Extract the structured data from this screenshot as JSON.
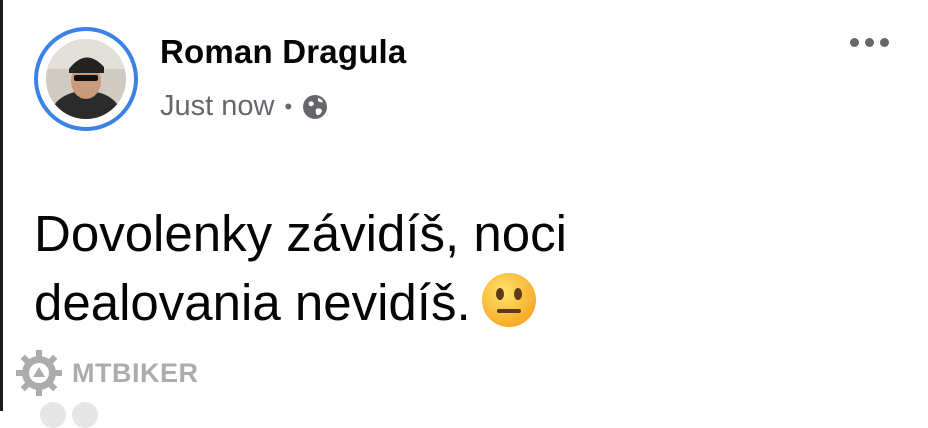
{
  "post": {
    "author": "Roman Dragula",
    "timestamp": "Just now",
    "separator": "•",
    "privacy_icon": "globe-icon",
    "menu_icon": "more-options-icon",
    "text_line1": "Dovolenky závidíš, noci",
    "text_line2": "dealovania nevidíš.",
    "emoji": "neutral-face-emoji"
  },
  "watermark": {
    "text": "MTBIKER",
    "logo_icon": "gear-logo-icon"
  },
  "colors": {
    "avatar_ring": "#3b82e6",
    "meta_text": "#65676b",
    "emoji_yellow": "#ffcc33"
  }
}
